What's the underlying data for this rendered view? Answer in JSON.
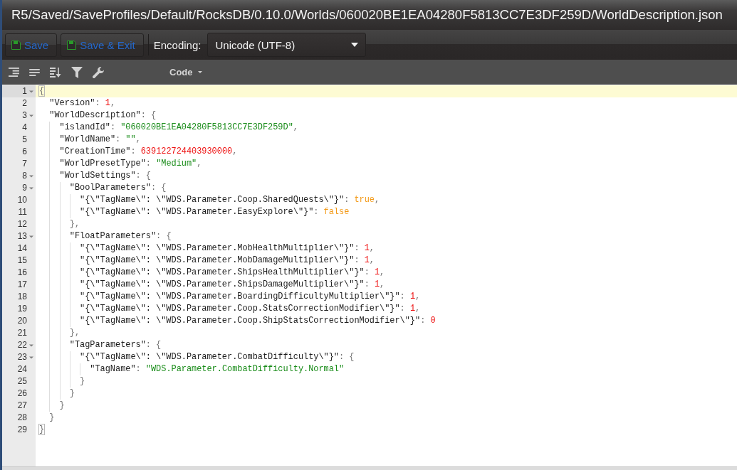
{
  "window": {
    "title": "R5/Saved/SaveProfiles/Default/RocksDB/0.10.0/Worlds/060020BE1EA04280F5813CC7E3DF259D/WorldDescription.json"
  },
  "toolbar": {
    "buttons": [
      {
        "label": "Save"
      },
      {
        "label": "Save & Exit"
      }
    ],
    "encoding": {
      "label": "Encoding:",
      "value": "Unicode (UTF-8)"
    }
  },
  "editor_toolbar": {
    "mode": "Code"
  },
  "editor": {
    "lines": [
      {
        "number": "1",
        "active": true,
        "expanded": true,
        "tokens": [
          {
            "kind": "brace_match",
            "text": "{"
          }
        ],
        "children": [
          {
            "number": "2",
            "active": false,
            "tokens": [
              {
                "kind": "key",
                "text": "\"Version\""
              },
              {
                "kind": "punct",
                "text": ": "
              },
              {
                "kind": "number",
                "text": "1"
              },
              {
                "kind": "punct",
                "text": ","
              }
            ]
          },
          {
            "number": "3",
            "active": false,
            "expanded": true,
            "tokens": [
              {
                "kind": "key",
                "text": "\"WorldDescription\""
              },
              {
                "kind": "punct",
                "text": ": {"
              }
            ],
            "children": [
              {
                "number": "4",
                "active": false,
                "tokens": [
                  {
                    "kind": "key",
                    "text": "\"islandId\""
                  },
                  {
                    "kind": "punct",
                    "text": ": "
                  },
                  {
                    "kind": "string",
                    "text": "\"060020BE1EA04280F5813CC7E3DF259D\""
                  },
                  {
                    "kind": "punct",
                    "text": ","
                  }
                ]
              },
              {
                "number": "5",
                "active": false,
                "tokens": [
                  {
                    "kind": "key",
                    "text": "\"WorldName\""
                  },
                  {
                    "kind": "punct",
                    "text": ": "
                  },
                  {
                    "kind": "string",
                    "text": "\"\""
                  },
                  {
                    "kind": "punct",
                    "text": ","
                  }
                ]
              },
              {
                "number": "6",
                "active": false,
                "tokens": [
                  {
                    "kind": "key",
                    "text": "\"CreationTime\""
                  },
                  {
                    "kind": "punct",
                    "text": ": "
                  },
                  {
                    "kind": "number",
                    "text": "639122724403930000"
                  },
                  {
                    "kind": "punct",
                    "text": ","
                  }
                ]
              },
              {
                "number": "7",
                "active": false,
                "tokens": [
                  {
                    "kind": "key",
                    "text": "\"WorldPresetType\""
                  },
                  {
                    "kind": "punct",
                    "text": ": "
                  },
                  {
                    "kind": "string",
                    "text": "\"Medium\""
                  },
                  {
                    "kind": "punct",
                    "text": ","
                  }
                ]
              },
              {
                "number": "8",
                "active": false,
                "expanded": true,
                "tokens": [
                  {
                    "kind": "key",
                    "text": "\"WorldSettings\""
                  },
                  {
                    "kind": "punct",
                    "text": ": {"
                  }
                ],
                "children": [
                  {
                    "number": "9",
                    "active": false,
                    "expanded": true,
                    "tokens": [
                      {
                        "kind": "key",
                        "text": "\"BoolParameters\""
                      },
                      {
                        "kind": "punct",
                        "text": ": {"
                      }
                    ],
                    "children": [
                      {
                        "number": "10",
                        "active": false,
                        "tokens": [
                          {
                            "kind": "key",
                            "text": "\"{\\\"TagName\\\": \\\"WDS.Parameter.Coop.SharedQuests\\\"}\""
                          },
                          {
                            "kind": "punct",
                            "text": ": "
                          },
                          {
                            "kind": "boolean",
                            "text": "true"
                          },
                          {
                            "kind": "punct",
                            "text": ","
                          }
                        ]
                      },
                      {
                        "number": "11",
                        "active": false,
                        "tokens": [
                          {
                            "kind": "key",
                            "text": "\"{\\\"TagName\\\": \\\"WDS.Parameter.EasyExplore\\\"}\""
                          },
                          {
                            "kind": "punct",
                            "text": ": "
                          },
                          {
                            "kind": "boolean",
                            "text": "false"
                          }
                        ]
                      }
                    ]
                  },
                  {
                    "number": "12",
                    "active": false,
                    "tokens": [
                      {
                        "kind": "punct",
                        "text": "},"
                      }
                    ]
                  },
                  {
                    "number": "13",
                    "active": false,
                    "expanded": true,
                    "tokens": [
                      {
                        "kind": "key",
                        "text": "\"FloatParameters\""
                      },
                      {
                        "kind": "punct",
                        "text": ": {"
                      }
                    ],
                    "children": [
                      {
                        "number": "14",
                        "active": false,
                        "tokens": [
                          {
                            "kind": "key",
                            "text": "\"{\\\"TagName\\\": \\\"WDS.Parameter.MobHealthMultiplier\\\"}\""
                          },
                          {
                            "kind": "punct",
                            "text": ": "
                          },
                          {
                            "kind": "number",
                            "text": "1"
                          },
                          {
                            "kind": "punct",
                            "text": ","
                          }
                        ]
                      },
                      {
                        "number": "15",
                        "active": false,
                        "tokens": [
                          {
                            "kind": "key",
                            "text": "\"{\\\"TagName\\\": \\\"WDS.Parameter.MobDamageMultiplier\\\"}\""
                          },
                          {
                            "kind": "punct",
                            "text": ": "
                          },
                          {
                            "kind": "number",
                            "text": "1"
                          },
                          {
                            "kind": "punct",
                            "text": ","
                          }
                        ]
                      },
                      {
                        "number": "16",
                        "active": false,
                        "tokens": [
                          {
                            "kind": "key",
                            "text": "\"{\\\"TagName\\\": \\\"WDS.Parameter.ShipsHealthMultiplier\\\"}\""
                          },
                          {
                            "kind": "punct",
                            "text": ": "
                          },
                          {
                            "kind": "number",
                            "text": "1"
                          },
                          {
                            "kind": "punct",
                            "text": ","
                          }
                        ]
                      },
                      {
                        "number": "17",
                        "active": false,
                        "tokens": [
                          {
                            "kind": "key",
                            "text": "\"{\\\"TagName\\\": \\\"WDS.Parameter.ShipsDamageMultiplier\\\"}\""
                          },
                          {
                            "kind": "punct",
                            "text": ": "
                          },
                          {
                            "kind": "number",
                            "text": "1"
                          },
                          {
                            "kind": "punct",
                            "text": ","
                          }
                        ]
                      },
                      {
                        "number": "18",
                        "active": false,
                        "tokens": [
                          {
                            "kind": "key",
                            "text": "\"{\\\"TagName\\\": \\\"WDS.Parameter.BoardingDifficultyMultiplier\\\"}\""
                          },
                          {
                            "kind": "punct",
                            "text": ": "
                          },
                          {
                            "kind": "number",
                            "text": "1"
                          },
                          {
                            "kind": "punct",
                            "text": ","
                          }
                        ]
                      },
                      {
                        "number": "19",
                        "active": false,
                        "tokens": [
                          {
                            "kind": "key",
                            "text": "\"{\\\"TagName\\\": \\\"WDS.Parameter.Coop.StatsCorrectionModifier\\\"}\""
                          },
                          {
                            "kind": "punct",
                            "text": ": "
                          },
                          {
                            "kind": "number",
                            "text": "1"
                          },
                          {
                            "kind": "punct",
                            "text": ","
                          }
                        ]
                      },
                      {
                        "number": "20",
                        "active": false,
                        "tokens": [
                          {
                            "kind": "key",
                            "text": "\"{\\\"TagName\\\": \\\"WDS.Parameter.Coop.ShipStatsCorrectionModifier\\\"}\""
                          },
                          {
                            "kind": "punct",
                            "text": ": "
                          },
                          {
                            "kind": "number",
                            "text": "0"
                          }
                        ]
                      }
                    ]
                  },
                  {
                    "number": "21",
                    "active": false,
                    "tokens": [
                      {
                        "kind": "punct",
                        "text": "},"
                      }
                    ]
                  },
                  {
                    "number": "22",
                    "active": false,
                    "expanded": true,
                    "tokens": [
                      {
                        "kind": "key",
                        "text": "\"TagParameters\""
                      },
                      {
                        "kind": "punct",
                        "text": ": {"
                      }
                    ],
                    "children": [
                      {
                        "number": "23",
                        "active": false,
                        "expanded": true,
                        "tokens": [
                          {
                            "kind": "key",
                            "text": "\"{\\\"TagName\\\": \\\"WDS.Parameter.CombatDifficulty\\\"}\""
                          },
                          {
                            "kind": "punct",
                            "text": ": {"
                          }
                        ],
                        "children": [
                          {
                            "number": "24",
                            "active": false,
                            "tokens": [
                              {
                                "kind": "key",
                                "text": "\"TagName\""
                              },
                              {
                                "kind": "punct",
                                "text": ": "
                              },
                              {
                                "kind": "string",
                                "text": "\"WDS.Parameter.CombatDifficulty.Normal\""
                              }
                            ]
                          }
                        ]
                      },
                      {
                        "number": "25",
                        "active": false,
                        "tokens": [
                          {
                            "kind": "punct",
                            "text": "}"
                          }
                        ]
                      }
                    ]
                  },
                  {
                    "number": "26",
                    "active": false,
                    "tokens": [
                      {
                        "kind": "punct",
                        "text": "}"
                      }
                    ]
                  }
                ]
              },
              {
                "number": "27",
                "active": false,
                "tokens": [
                  {
                    "kind": "punct",
                    "text": "}"
                  }
                ]
              }
            ]
          },
          {
            "number": "28",
            "active": false,
            "tokens": [
              {
                "kind": "punct",
                "text": "}"
              }
            ]
          }
        ]
      },
      {
        "number": "29",
        "active": false,
        "tokens": [
          {
            "kind": "brace_match",
            "text": "}"
          }
        ]
      }
    ]
  }
}
